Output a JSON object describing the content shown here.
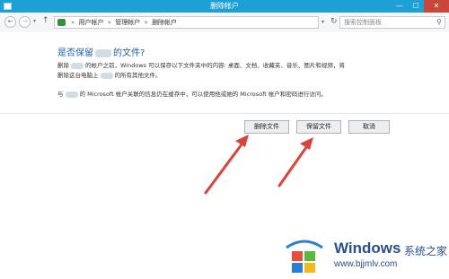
{
  "window": {
    "title": "删除帐户",
    "minimize": "—",
    "maximize": "☐",
    "close": "✕"
  },
  "address": {
    "back": "←",
    "forward": "→",
    "dropdown": "▾",
    "up": "↑",
    "crumb_separator": "»",
    "breadcrumbs": [
      "用户帐户",
      "管理帐户",
      "删除帐户"
    ],
    "search_placeholder": "搜索控制面板",
    "refresh": "↻"
  },
  "dialog": {
    "heading_before": "是否保留",
    "heading_after": "的文件?",
    "para1_line1_a": "删除",
    "para1_line1_b": "的帐户之前，Windows 可以保存以下文件夹中的内容: 桌面、文档、收藏夹、音乐、图片和视频，将",
    "para1_line2_a": "删除这台电脑上",
    "para1_line2_b": "的所有其他文件。",
    "para2_a": "与",
    "para2_b": "的 Microsoft 帐户关联的信息仍在缓存中，可以使用他或她的 Microsoft 帐户和密码进行访问。",
    "buttons": {
      "delete": "删除文件",
      "keep": "保留文件",
      "cancel": "取消"
    }
  },
  "watermark": {
    "title": "Windows",
    "subtitle": "系统之家",
    "url": "www.bjjmlv.com"
  },
  "colors": {
    "titlebar": "#1e9fd6",
    "heading": "#1a5fa3",
    "arrow": "#d9443a",
    "watermark": "#2a4f8a"
  }
}
